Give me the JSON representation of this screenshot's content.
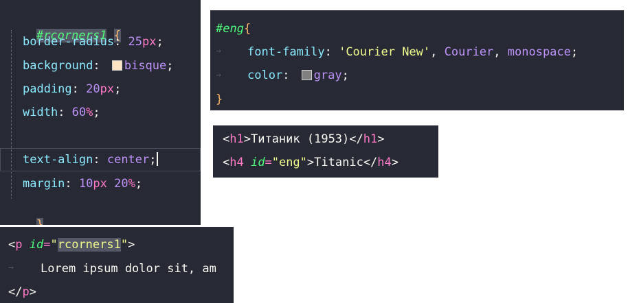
{
  "css_rcorners": {
    "selector": "#rcorners1",
    "open_brace": "{",
    "close_brace": "}",
    "border_radius": {
      "prop": "border-radius",
      "colon": ": ",
      "num": "25",
      "unit": "px",
      "end": ";"
    },
    "background": {
      "prop": "background",
      "colon": ": ",
      "value": "bisque",
      "swatch_color": "#ffe4c4",
      "end": ";"
    },
    "padding": {
      "prop": "padding",
      "colon": ": ",
      "num": "20",
      "unit": "px",
      "end": ";"
    },
    "width": {
      "prop": "width",
      "colon": ": ",
      "num": "60",
      "unit": "%",
      "end": ";"
    },
    "text_align": {
      "prop": "text-align",
      "colon": ": ",
      "value": "center",
      "end": ";"
    },
    "margin": {
      "prop": "margin",
      "colon": ": ",
      "num1": "10",
      "unit1": "px",
      "space": " ",
      "num2": "20",
      "unit2": "%",
      "end": ";"
    }
  },
  "css_eng": {
    "selector": "#eng",
    "open_brace": "{",
    "close_brace": "}",
    "font_family": {
      "prop": "font-family",
      "colon": ": ",
      "v1": "'Courier New'",
      "comma1": ", ",
      "v2": "Courier",
      "comma2": ", ",
      "v3": "monospace",
      "end": ";"
    },
    "color": {
      "prop": "color",
      "colon": ": ",
      "value": "gray",
      "swatch_color": "#808080",
      "end": ";"
    }
  },
  "html_titanic": {
    "h1": {
      "open_lt": "<",
      "tag": "h1",
      "open_gt": ">",
      "text": "Титаник (1953)",
      "close_lt": "</",
      "close_gt": ">"
    },
    "h4": {
      "open_lt": "<",
      "tag": "h4",
      "sp": " ",
      "attr": "id",
      "eq": "=",
      "val": "\"eng\"",
      "open_gt": ">",
      "text": "Titanic",
      "close_lt": "</",
      "close_gt": ">"
    }
  },
  "html_p": {
    "open_lt": "<",
    "tag": "p",
    "sp": " ",
    "attr": "id",
    "eq": "=",
    "q1": "\"",
    "val": "rcorners1",
    "q2": "\"",
    "open_gt": ">",
    "text": "Lorem ipsum dolor sit, am",
    "close_lt": "</",
    "close_gt": ">"
  },
  "colors": {
    "editor_bg": "#272935",
    "pink": "#ff79c6",
    "green": "#50fa7b",
    "cyan": "#8be9fd",
    "purple": "#bd93f9",
    "yellow": "#f1fa8c",
    "orange": "#ffb86c"
  },
  "icons": {
    "indent_arrow": "indent-arrow-icon"
  }
}
